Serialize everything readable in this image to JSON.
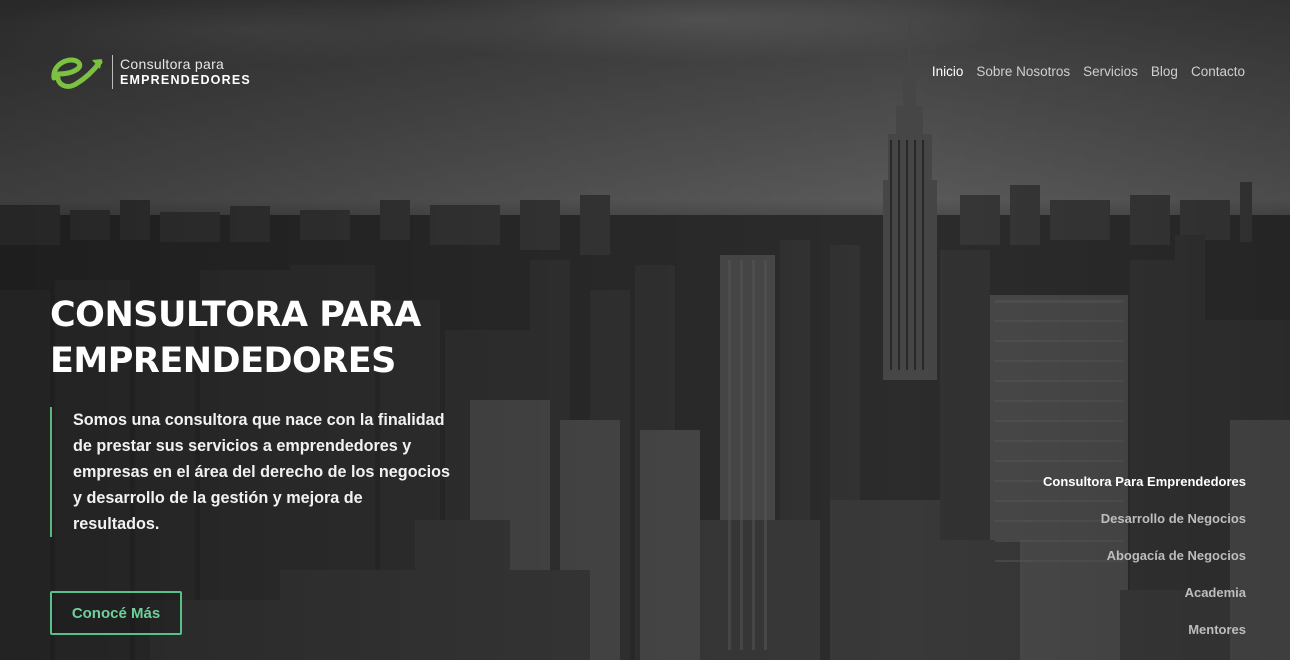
{
  "logo": {
    "line1": "Consultora para",
    "line2": "EMPRENDEDORES",
    "icon": "e-arrow-logo",
    "accent_color": "#7cc142"
  },
  "nav": {
    "items": [
      {
        "label": "Inicio",
        "active": true
      },
      {
        "label": "Sobre Nosotros",
        "active": false
      },
      {
        "label": "Servicios",
        "active": false
      },
      {
        "label": "Blog",
        "active": false
      },
      {
        "label": "Contacto",
        "active": false
      }
    ]
  },
  "hero": {
    "title_line1": "CONSULTORA PARA",
    "title_line2": "EMPRENDEDORES",
    "description": "Somos una consultora que nace con la finalidad de prestar sus servicios a emprendedores y empresas en el área del derecho de los negocios y desarrollo de la gestión y mejora de resultados.",
    "cta_label": "Conocé Más",
    "accent_color": "#59c08a"
  },
  "slider_nav": {
    "items": [
      {
        "label": "Consultora Para Emprendedores",
        "active": true
      },
      {
        "label": "Desarrollo de Negocios",
        "active": false
      },
      {
        "label": "Abogacía de Negocios",
        "active": false
      },
      {
        "label": "Academia",
        "active": false
      },
      {
        "label": "Mentores",
        "active": false
      }
    ]
  }
}
